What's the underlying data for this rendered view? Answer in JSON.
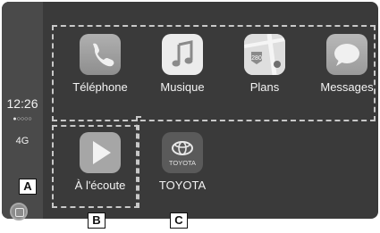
{
  "status": {
    "time": "12:26",
    "signal": "●○○○○",
    "network": "4G"
  },
  "apps": [
    {
      "label": "Téléphone",
      "icon": "phone-icon"
    },
    {
      "label": "Musique",
      "icon": "music-note-icon"
    },
    {
      "label": "Plans",
      "icon": "maps-icon"
    },
    {
      "label": "Messages",
      "icon": "speech-bubble-icon"
    },
    {
      "label": "À l'écoute",
      "icon": "play-icon"
    },
    {
      "label": "TOYOTA",
      "icon": "toyota-logo-icon",
      "logo_text": "TOYOTA"
    }
  ],
  "map_badge": "280",
  "callouts": {
    "a": "A",
    "b": "B",
    "c": "C"
  }
}
